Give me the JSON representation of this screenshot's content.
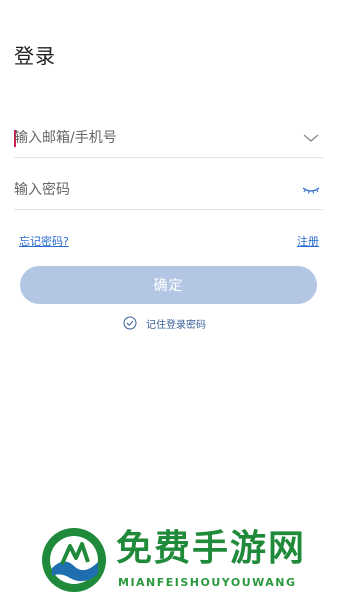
{
  "header": {
    "title": "登录"
  },
  "form": {
    "account": {
      "placeholder": "输入邮箱/手机号",
      "value": "",
      "dropdown_icon": "chevron-down-icon"
    },
    "password": {
      "placeholder": "输入密码",
      "value": "",
      "visibility_icon": "eye-closed-icon"
    },
    "forgot_link": "忘记密码?",
    "register_link": "注册",
    "confirm_label": "确定",
    "remember_label": "记住登录密码",
    "remember_icon": "check-circle-icon"
  },
  "watermark": {
    "text": "免费手游网",
    "subtext": "MIANFEISHOUYOUWANG"
  },
  "colors": {
    "accent": "#2a6bd1",
    "button_disabled": "#b3c6e3",
    "caret": "#d0184b",
    "watermark_green": "#1f8a3a"
  }
}
